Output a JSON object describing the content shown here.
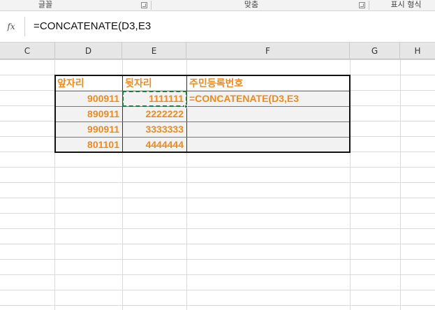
{
  "ribbon": {
    "groups": [
      "글꼴",
      "맞춤",
      "표시 형식"
    ]
  },
  "formula_bar": {
    "icon": "fx-icon",
    "icon_label": "fx",
    "value": "=CONCATENATE(D3,E3"
  },
  "columns": [
    "C",
    "D",
    "E",
    "F",
    "G",
    "H"
  ],
  "table": {
    "headers": [
      "앞자리",
      "뒷자리",
      "주민등록번호"
    ],
    "rows": [
      {
        "front": "900911",
        "back": "1111111",
        "id": "=CONCATENATE(D3,E3"
      },
      {
        "front": "890911",
        "back": "2222222",
        "id": ""
      },
      {
        "front": "990911",
        "back": "3333333",
        "id": ""
      },
      {
        "front": "801101",
        "back": "4444444",
        "id": ""
      }
    ]
  },
  "colors": {
    "data_text": "#f08a1c",
    "copy_marquee": "#1f7a3e",
    "header_bg": "#e6e6e6"
  }
}
